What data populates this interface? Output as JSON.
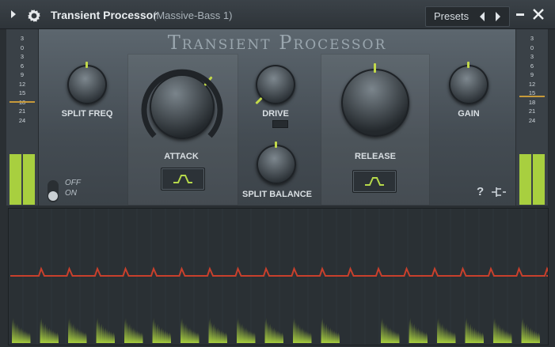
{
  "titlebar": {
    "title": "Transient Processor",
    "subtitle": "(Massive-Bass 1)",
    "presets_label": "Presets",
    "menu_icon": "triangle-right",
    "plugin_icon": "gear",
    "prev_icon": "chevron-left",
    "next_icon": "chevron-right",
    "minimize_icon": "minus",
    "close_icon": "x"
  },
  "plugin_name": "Transient Processor",
  "meter_scale": [
    "3",
    "0",
    "3",
    "6",
    "9",
    "12",
    "15",
    "18",
    "21",
    "24"
  ],
  "knobs": {
    "split_freq": "SPLIT FREQ",
    "attack": "ATTACK",
    "drive": "DRIVE",
    "split_balance": "SPLIT BALANCE",
    "release": "RELEASE",
    "gain": "GAIN"
  },
  "toggle": {
    "off": "OFF",
    "on": "ON"
  },
  "help": "?",
  "colors": {
    "accent_green": "#a8cf3f",
    "gain_line_red": "#c8402c",
    "meter_marker": "#c79a3a"
  }
}
